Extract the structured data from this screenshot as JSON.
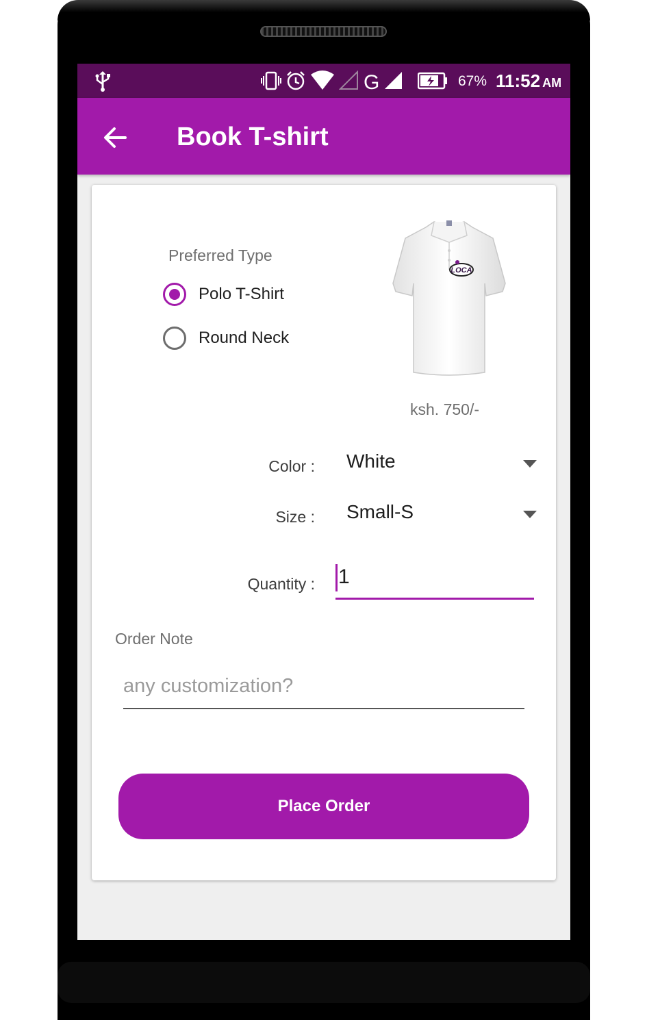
{
  "status_bar": {
    "battery_percent": "67%",
    "time": "11:52",
    "ampm": "AM",
    "network_label": "G"
  },
  "app_bar": {
    "title": "Book T-shirt",
    "back_icon": "arrow-left-icon"
  },
  "form": {
    "preferred_type_label": "Preferred Type",
    "types": [
      {
        "label": "Polo T-Shirt",
        "selected": true
      },
      {
        "label": "Round Neck",
        "selected": false
      }
    ],
    "price": "ksh. 750/-",
    "shirt_logo_text": "LOCA",
    "color_label": "Color :",
    "color_value": "White",
    "size_label": "Size :",
    "size_value": "Small-S",
    "quantity_label": "Quantity :",
    "quantity_value": "1",
    "order_note_label": "Order Note",
    "order_note_placeholder": "any customization?",
    "place_order_label": "Place Order"
  },
  "colors": {
    "accent": "#a21aaa",
    "status_bar": "#5a0d5a"
  }
}
